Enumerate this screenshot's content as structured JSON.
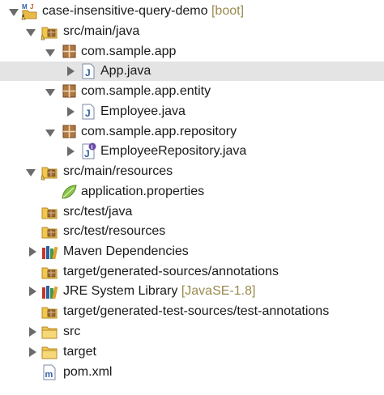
{
  "project": {
    "name": "case-insensitive-query-demo",
    "decoration": "[boot]",
    "icon": "maven-java-project-icon"
  },
  "items": {
    "src_main_java": "src/main/java",
    "pkg_app": "com.sample.app",
    "app_java": "App.java",
    "pkg_entity": "com.sample.app.entity",
    "employee_java": "Employee.java",
    "pkg_repository": "com.sample.app.repository",
    "employee_repo_java": "EmployeeRepository.java",
    "src_main_resources": "src/main/resources",
    "application_properties": "application.properties",
    "src_test_java": "src/test/java",
    "src_test_resources": "src/test/resources",
    "maven_deps": "Maven Dependencies",
    "target_gen_sources": "target/generated-sources/annotations",
    "jre_lib": "JRE System Library",
    "jre_deco": "[JavaSE-1.8]",
    "target_gen_test_sources": "target/generated-test-sources/test-annotations",
    "src": "src",
    "target": "target",
    "pom": "pom.xml"
  },
  "colors": {
    "selection": "#e4e4e4",
    "folder": "#e9b949",
    "package": "#9b6a3a",
    "java_blue": "#2d5fa6",
    "decoration": "#9a8a4e"
  }
}
